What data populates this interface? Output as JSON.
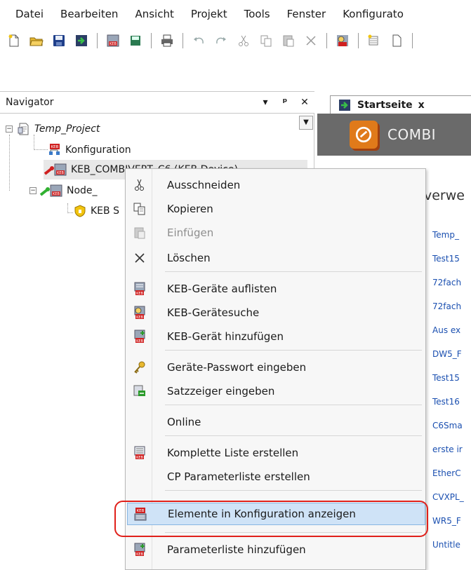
{
  "menubar": [
    "Datei",
    "Bearbeiten",
    "Ansicht",
    "Projekt",
    "Tools",
    "Fenster",
    "Konfigurato"
  ],
  "toolbar": {
    "icons": [
      "new-icon",
      "open-icon",
      "save-icon",
      "import-icon",
      "keb-device-icon",
      "save-all-icon",
      "print-icon",
      "undo-icon",
      "redo-icon",
      "cut-icon",
      "copy-icon",
      "paste-icon",
      "delete-icon",
      "keb-search-icon",
      "new-item-icon",
      "document-icon"
    ]
  },
  "navigator": {
    "title": "Navigator",
    "controls": {
      "dropdown": "▾",
      "pin": "ᵖ",
      "close": "✕"
    },
    "tree": [
      {
        "label": "Temp_Project",
        "icon": "project-icon",
        "italic": true
      },
      {
        "label": "Konfiguration",
        "icon": "keb-config-icon"
      },
      {
        "label": "KEB_COMBIVERT_C6 (KEB Device)",
        "icon": "keb-device-red-icon",
        "selected": true
      },
      {
        "label": "Node_",
        "icon": "keb-device-green-icon"
      },
      {
        "label": "KEB S",
        "icon": "shield-icon"
      }
    ]
  },
  "document": {
    "tab": {
      "label": "Startseite",
      "close": "x"
    },
    "banner_text": "COMBI",
    "recent_heading": "verwe",
    "recent_items": [
      "Temp_",
      "Test15",
      "72fach",
      "72fach",
      "Aus ex",
      "DW5_F",
      "Test15",
      "Test16",
      "C6Sma",
      "erste ir",
      "EtherC",
      "CVXPL_",
      "WR5_F",
      "Untitle"
    ]
  },
  "context_menu": {
    "items": [
      {
        "label": "Ausschneiden",
        "icon": "scissors-icon",
        "enabled": true
      },
      {
        "label": "Kopieren",
        "icon": "copy-icon",
        "enabled": true
      },
      {
        "label": "Einfügen",
        "icon": "paste-icon",
        "enabled": false
      },
      {
        "label": "Löschen",
        "icon": "delete-x-icon",
        "enabled": true
      },
      {
        "label": "KEB-Geräte auflisten",
        "icon": "keb-list-icon",
        "enabled": true
      },
      {
        "label": "KEB-Gerätesuche",
        "icon": "keb-search-icon",
        "enabled": true
      },
      {
        "label": "KEB-Gerät hinzufügen",
        "icon": "keb-add-icon",
        "enabled": true
      },
      {
        "label": "Geräte-Passwort eingeben",
        "icon": "key-icon",
        "enabled": true
      },
      {
        "label": "Satzzeiger eingeben",
        "icon": "set-pointer-icon",
        "enabled": true
      },
      {
        "label": "Online",
        "icon": "",
        "enabled": true
      },
      {
        "label": "Komplette Liste erstellen",
        "icon": "keb-list-create-icon",
        "enabled": true
      },
      {
        "label": "CP Parameterliste erstellen",
        "icon": "",
        "enabled": true
      },
      {
        "label": "Elemente in Konfiguration anzeigen",
        "icon": "keb-config-show-icon",
        "enabled": true,
        "highlighted": true
      },
      {
        "label": "Parameterliste hinzufügen",
        "icon": "keb-param-add-icon",
        "enabled": true
      }
    ]
  },
  "colors": {
    "highlight": "#cfe3f7",
    "annotation": "#e0201a",
    "link": "#1a4fb0",
    "banner": "#6a6a6a"
  }
}
